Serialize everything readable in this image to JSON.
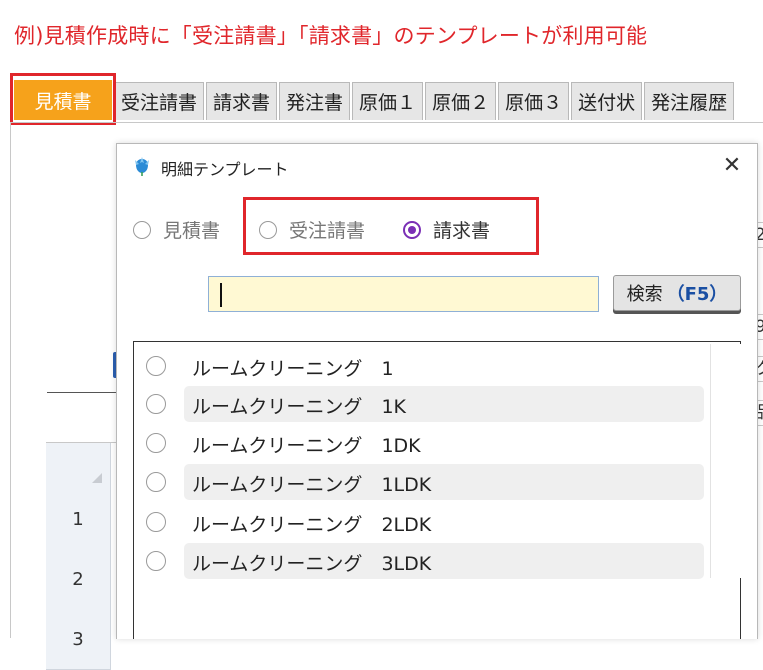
{
  "caption": "例)見積作成時に「受注請書」「請求書」のテンプレートが利用可能",
  "tabs": [
    {
      "label": "見積書",
      "active": true
    },
    {
      "label": "受注請書"
    },
    {
      "label": "請求書"
    },
    {
      "label": "発注書"
    },
    {
      "label": "原価１"
    },
    {
      "label": "原価２"
    },
    {
      "label": "原価３"
    },
    {
      "label": "送付状"
    },
    {
      "label": "発注履歴"
    }
  ],
  "background": {
    "row_numbers": [
      "1",
      "2",
      "3"
    ],
    "edge_fragments": [
      "24",
      "9",
      "ク",
      "品"
    ]
  },
  "dialog": {
    "title": "明細テンプレート",
    "close_symbol": "✕",
    "radio_options": [
      {
        "label": "見積書",
        "selected": false
      },
      {
        "label": "受注請書",
        "selected": false
      },
      {
        "label": "請求書",
        "selected": true
      }
    ],
    "search_value": "",
    "search_button": {
      "label": "検索",
      "shortcut": "（F5）"
    },
    "templates": [
      {
        "name": "ルームクリーニング",
        "type": "1"
      },
      {
        "name": "ルームクリーニング",
        "type": "1K"
      },
      {
        "name": "ルームクリーニング",
        "type": "1DK"
      },
      {
        "name": "ルームクリーニング",
        "type": "1LDK"
      },
      {
        "name": "ルームクリーニング",
        "type": "2LDK"
      },
      {
        "name": "ルームクリーニング",
        "type": "3LDK"
      }
    ]
  },
  "colors": {
    "accent_red": "#e0262b",
    "active_tab": "#f6a21b",
    "radio_selected": "#7a2fb5",
    "input_bg": "#fff9d3",
    "shortcut_blue": "#1a4fa3"
  }
}
